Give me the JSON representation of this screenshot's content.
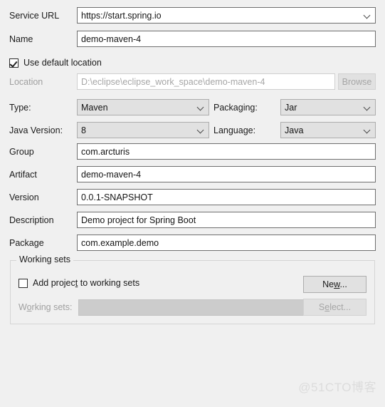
{
  "form": {
    "service_url": {
      "label": "Service URL",
      "value": "https://start.spring.io",
      "icon": "chevron-down-icon"
    },
    "name": {
      "label": "Name",
      "value": "demo-maven-4"
    },
    "use_default_location": {
      "label": "Use default location",
      "checked": true
    },
    "location": {
      "label": "Location",
      "value": "D:\\eclipse\\eclipse_work_space\\demo-maven-4",
      "enabled": false
    },
    "browse_button": {
      "label": "Browse",
      "enabled": false
    },
    "type": {
      "label": "Type:",
      "value": "Maven"
    },
    "packaging": {
      "label": "Packaging:",
      "value": "Jar"
    },
    "java_version": {
      "label": "Java Version:",
      "value": "8"
    },
    "language": {
      "label": "Language:",
      "value": "Java"
    },
    "group": {
      "label": "Group",
      "value": "com.arcturis"
    },
    "artifact": {
      "label": "Artifact",
      "value": "demo-maven-4"
    },
    "version": {
      "label": "Version",
      "value": "0.0.1-SNAPSHOT"
    },
    "description": {
      "label": "Description",
      "value": "Demo project for Spring Boot"
    },
    "package": {
      "label": "Package",
      "value": "com.example.demo"
    }
  },
  "working_sets": {
    "group_title": "Working sets",
    "add_project_checkbox": {
      "label_before": "Add projec",
      "label_mnemonic": "t",
      "label_after": " to working sets",
      "checked": false
    },
    "new_button": {
      "label_before": "Ne",
      "label_mnemonic": "w",
      "label_after": "...",
      "enabled": true
    },
    "sets_label": {
      "label_before": "W",
      "label_mnemonic": "o",
      "label_after": "rking sets:",
      "enabled": false
    },
    "sets_combo": {
      "value": "",
      "enabled": false
    },
    "select_button": {
      "label_before": "S",
      "label_mnemonic": "e",
      "label_after": "lect...",
      "enabled": false
    }
  },
  "watermark": {
    "text": "@51CTO博客"
  },
  "colors": {
    "background": "#f0f0f0",
    "field_background": "#ffffff",
    "field_border": "#6f6f6f",
    "combo_grey": "#e1e1e1",
    "disabled_text": "#a6a6a6",
    "text": "#1a1a1a"
  }
}
